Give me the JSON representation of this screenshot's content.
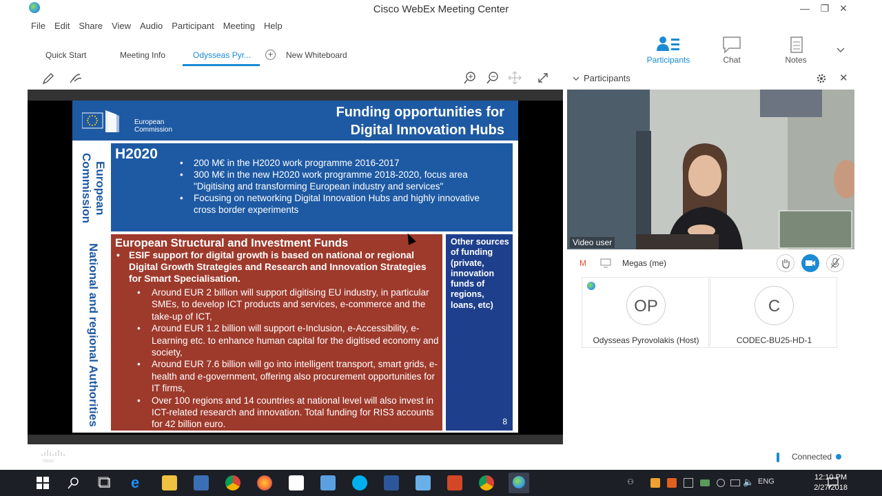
{
  "window": {
    "title": "Cisco WebEx Meeting Center",
    "minimize": "—",
    "restore": "❐",
    "close": "✕"
  },
  "menu": [
    "File",
    "Edit",
    "Share",
    "View",
    "Audio",
    "Participant",
    "Meeting",
    "Help"
  ],
  "tabs": {
    "quick_start": "Quick Start",
    "meeting_info": "Meeting Info",
    "shared": "Odysseas Pyr...",
    "new_whiteboard": "New Whiteboard"
  },
  "panel_tabs": {
    "participants": "Participants",
    "chat": "Chat",
    "notes": "Notes"
  },
  "slide": {
    "org_line1": "European",
    "org_line2": "Commission",
    "title_line1": "Funding opportunities for",
    "title_line2": "Digital Innovation Hubs",
    "side_top": "European Commission",
    "side_bottom": "National and regional Authorities",
    "h2020_title": "H2020",
    "h2020_items": [
      "200 M€ in the H2020 work programme 2016-2017",
      "300 M€ in the new H2020 work programme 2018-2020, focus area \"Digitising and transforming European industry and services\"",
      "Focusing on networking Digital Innovation Hubs and highly innovative cross border experiments"
    ],
    "esif_title": "European Structural and Investment Funds",
    "esif_main": "ESIF support for digital growth is based on national or regional Digital Growth Strategies and Research and Innovation Strategies for Smart Specialisation.",
    "esif_items": [
      "Around EUR 2 billion will support digitising EU industry, in particular SMEs, to develop ICT products and services, e-commerce and the take-up of ICT,",
      "Around EUR 1.2 billion will support e-Inclusion, e-Accessibility, e-Learning etc. to enhance human capital for the digitised economy and society,",
      "Around EUR 7.6 billion will go into intelligent transport, smart grids, e-health and e-government, offering also procurement opportunities for IT firms,",
      "Over 100 regions and 14 countries  at national level will also invest in ICT-related research and innovation. Total funding for RIS3 accounts for 42 billion euro."
    ],
    "other_text": "Other sources of funding (private, innovation funds of regions, loans, etc)",
    "page_number": "8"
  },
  "participants_panel": {
    "header": "Participants",
    "video_label": "Video user",
    "me_initial": "M",
    "me_name": "Megas (me)",
    "participants": [
      {
        "initials": "OP",
        "name": "Odysseas Pyrovolakis (Host)"
      },
      {
        "initials": "C",
        "name": "CODEC-BU25-HD-1"
      }
    ]
  },
  "status": {
    "connected": "Connected"
  },
  "taskbar": {
    "language": "ENG",
    "time": "12:10 PM",
    "date": "2/27/2018"
  },
  "colors": {
    "accent": "#1a8ad4",
    "slide_blue": "#1e5aa3",
    "slide_red": "#9e3a2c"
  }
}
